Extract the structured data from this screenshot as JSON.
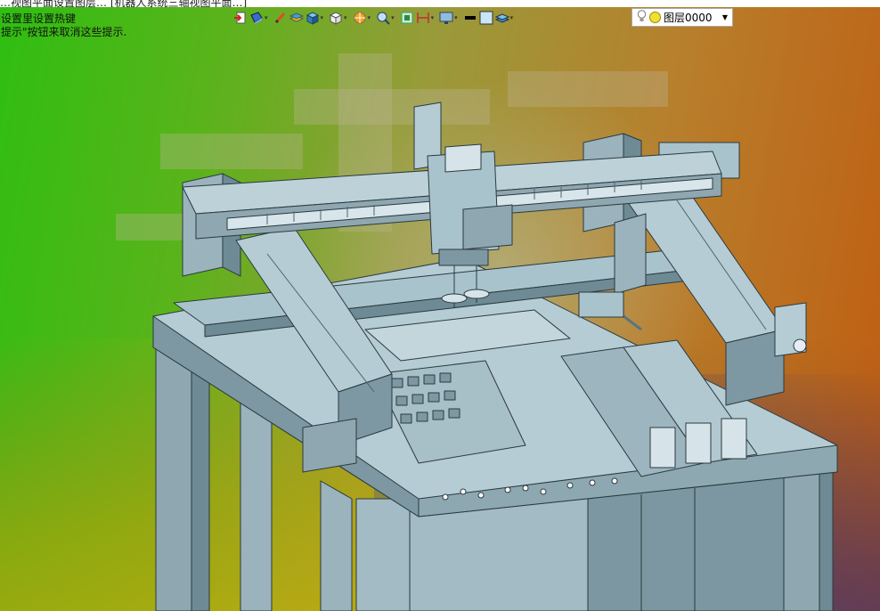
{
  "window": {
    "title_fragment": "…视图平面设置图层…  [机器人系统三轴视图平面…]"
  },
  "hints": {
    "line1": "设置里设置热键",
    "line2": "提示\"按钮来取消这些提示."
  },
  "toolbar": {
    "items": [
      {
        "name": "import-icon"
      },
      {
        "name": "view-icon"
      },
      {
        "name": "pen-icon"
      },
      {
        "name": "layer-stack-icon"
      },
      {
        "name": "cube-blue-icon"
      },
      {
        "name": "cube-white-icon"
      },
      {
        "name": "render-icon"
      },
      {
        "name": "zoom-icon"
      },
      {
        "name": "fit-icon"
      },
      {
        "name": "dimension-icon"
      },
      {
        "name": "display-icon"
      },
      {
        "name": "line-color-icon"
      },
      {
        "name": "fill-color-icon"
      },
      {
        "name": "layers-icon"
      }
    ]
  },
  "layer_select": {
    "value": "图层0000"
  },
  "colors": {
    "model": "#a9c3cc",
    "model_dark": "#6e8a94",
    "edge": "#2a3a40",
    "bg_left": "#2fbe12",
    "bg_right": "#c05c10"
  }
}
